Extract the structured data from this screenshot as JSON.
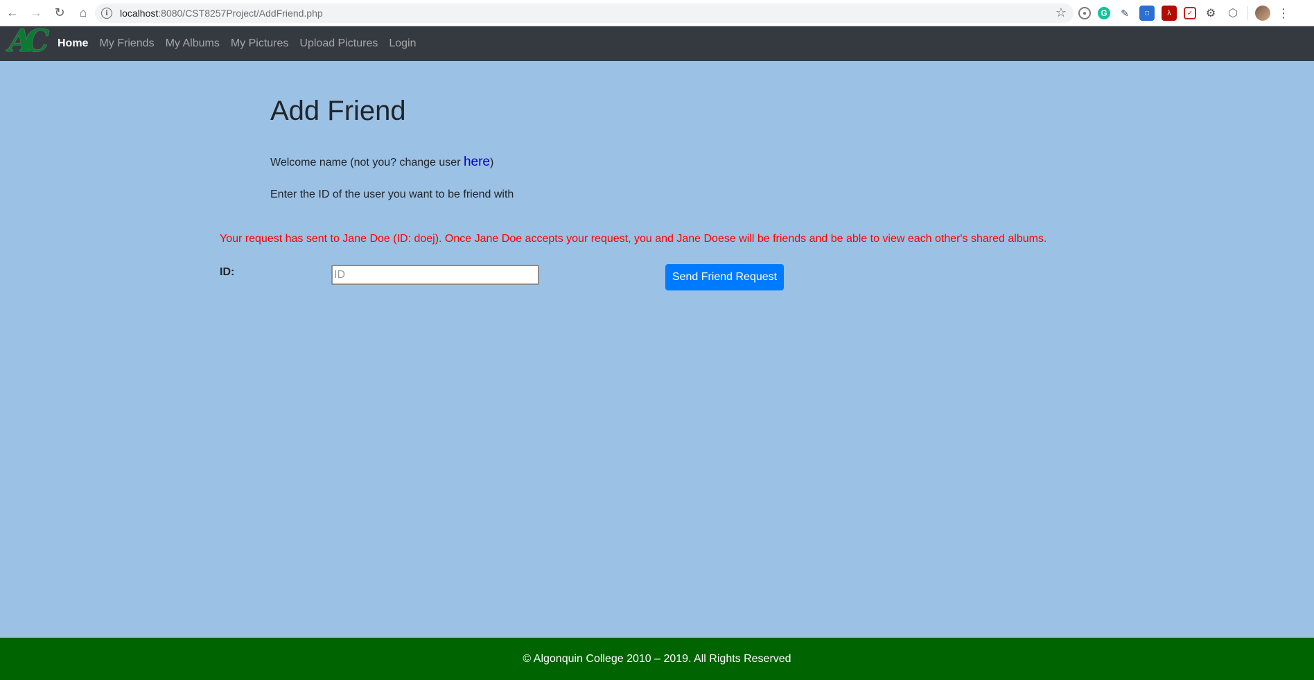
{
  "browser": {
    "url_host": "localhost",
    "url_rest": ":8080/CST8257Project/AddFriend.php",
    "back_icon": "arrow-left-icon",
    "forward_icon": "arrow-right-icon",
    "reload_icon": "reload-icon",
    "home_icon": "home-icon"
  },
  "navbar": {
    "logo_text": "AC",
    "links": [
      {
        "label": "Home",
        "active": true
      },
      {
        "label": "My Friends",
        "active": false
      },
      {
        "label": "My Albums",
        "active": false
      },
      {
        "label": "My Pictures",
        "active": false
      },
      {
        "label": "Upload Pictures",
        "active": false
      },
      {
        "label": "Login",
        "active": false
      }
    ],
    "background": "#343a40"
  },
  "main": {
    "title": "Add Friend",
    "welcome_prefix": "Welcome name (not you? change user ",
    "welcome_link": "here",
    "welcome_suffix": ")",
    "instructions": "Enter the ID of the user you want to be friend with",
    "status_message": "Your request has sent to Jane Doe (ID: doej). Once Jane Doe accepts your request, you and Jane Doese will be friends and be able to view each other's shared albums.",
    "status_color": "#ff0000",
    "id_label": "ID:",
    "id_placeholder": "ID",
    "id_value": "",
    "submit_label": "Send Friend Request",
    "background": "#9bc1e4"
  },
  "footer": {
    "text": "© Algonquin College 2010 – 2019. All Rights Reserved",
    "background": "#006400"
  }
}
